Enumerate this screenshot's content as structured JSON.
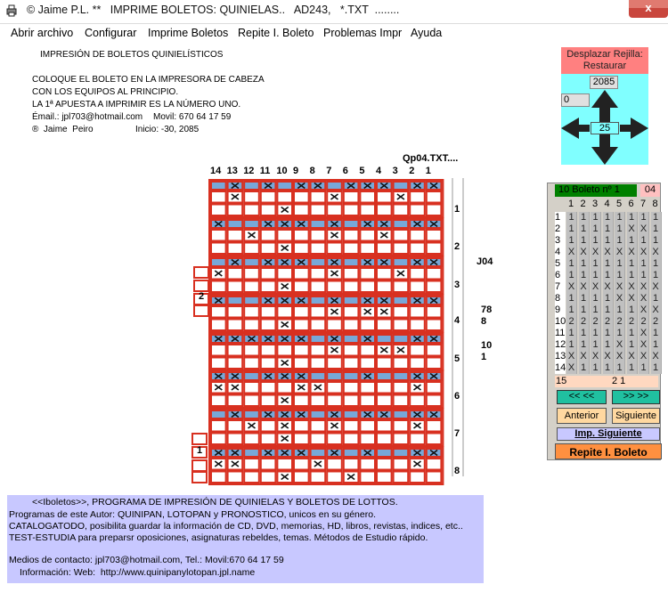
{
  "window": {
    "title": "© Jaime P.L. **   IMPRIME BOLETOS: QUINIELAS..   AD243,   *.TXT  ........",
    "close_label": "x"
  },
  "menu": [
    "Abrir archivo",
    "Configurar",
    "Imprime Boletos",
    "Repite I. Boleto",
    "Problemas Impr",
    "Ayuda"
  ],
  "info": {
    "heading": "IMPRESIÓN DE BOLETOS QUINIELÍSTICOS",
    "line1": "COLOQUE EL BOLETO EN LA IMPRESORA DE CABEZA",
    "line2": "CON LOS EQUIPOS AL PRINCIPIO.",
    "line3": "LA 1ª APUESTA A IMPRIMIR ES LA NÚMERO UNO.",
    "email_label": "Émail.: jpl703@hotmail.com",
    "phone": "Movil: 670 64 17 59",
    "author": "®  Jaime  Peiro",
    "start": "Inicio: -30, 2085"
  },
  "ticket": {
    "file": "Qp04.TXT....",
    "columns": [
      "14",
      "13",
      "12",
      "11",
      "10",
      "9",
      "8",
      "7",
      "6",
      "5",
      "4",
      "3",
      "2",
      "1"
    ],
    "block_labels": [
      "1",
      "2",
      "3",
      "4",
      "5",
      "6",
      "7",
      "8"
    ],
    "side_labels": [
      "J04",
      "78",
      "8",
      "10",
      "1"
    ],
    "mark_left_a": "2",
    "mark_left_b": "1"
  },
  "footer": {
    "l1": "<<Iboletos>>, PROGRAMA DE IMPRESIÓN DE QUINIELAS Y BOLETOS DE LOTTOS.",
    "l2": "Programas de este Autor: QUINIPAN, LOTOPAN y PRONOSTICO, unicos en su género.",
    "l3": "CATALOGATODO, posibilita guardar la información de CD, DVD, memorias, HD, libros, revistas, indices, etc..",
    "l4": "TEST-ESTUDIA para preparsr oposiciones, asignaturas rebeldes, temas. Métodos de Estudio rápido.",
    "l5": "Medios de contacto: jpl703@hotmail.com, Tel.: Movil:670 64 17 59",
    "l6": "Información: Web:  http://www.quinipanylotopan.jpl.name"
  },
  "nav": {
    "header": "Desplazar Rejilla: Restaurar",
    "year": "2085",
    "left_value": "0",
    "center_value": "25"
  },
  "boleto": {
    "title": "10  Boleto nº 1",
    "number": "04",
    "cols": [
      "1",
      "2",
      "3",
      "4",
      "5",
      "6",
      "7",
      "8"
    ],
    "rows": [
      "1",
      "2",
      "3",
      "4",
      "5",
      "6",
      "7",
      "8",
      "9",
      "10",
      "11",
      "12",
      "13",
      "14"
    ],
    "cells": [
      [
        "1",
        "1",
        "1",
        "1",
        "1",
        "1",
        "1",
        "1"
      ],
      [
        "1",
        "1",
        "1",
        "1",
        "1",
        "X",
        "X",
        "1"
      ],
      [
        "1",
        "1",
        "1",
        "1",
        "1",
        "1",
        "1",
        "1"
      ],
      [
        "X",
        "X",
        "X",
        "X",
        "X",
        "X",
        "X",
        "X"
      ],
      [
        "1",
        "1",
        "1",
        "1",
        "1",
        "1",
        "1",
        "1"
      ],
      [
        "1",
        "1",
        "1",
        "1",
        "1",
        "1",
        "1",
        "1"
      ],
      [
        "X",
        "X",
        "X",
        "X",
        "X",
        "X",
        "X",
        "X"
      ],
      [
        "1",
        "1",
        "1",
        "1",
        "X",
        "X",
        "X",
        "1"
      ],
      [
        "1",
        "1",
        "1",
        "1",
        "1",
        "1",
        "X",
        "X"
      ],
      [
        "2",
        "2",
        "2",
        "2",
        "2",
        "2",
        "2",
        "2"
      ],
      [
        "1",
        "1",
        "1",
        "1",
        "1",
        "1",
        "X",
        "1"
      ],
      [
        "1",
        "1",
        "1",
        "1",
        "X",
        "1",
        "X",
        "1"
      ],
      [
        "X",
        "X",
        "X",
        "X",
        "X",
        "X",
        "X",
        "X"
      ],
      [
        "X",
        "1",
        "1",
        "1",
        "1",
        "1",
        "1",
        "1"
      ]
    ],
    "row15": "15",
    "row15_value": "2 1",
    "prev_arrows": "<<  <<",
    "next_arrows": ">>  >>",
    "anterior": "Anterior",
    "siguiente": "Siguiente",
    "imp_siguiente": "Imp. Siguiente",
    "repite": "Repite I. Boleto"
  }
}
